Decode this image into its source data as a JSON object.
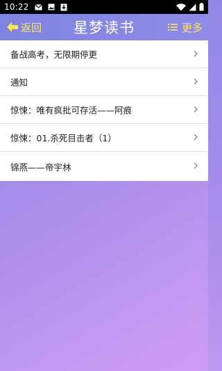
{
  "status_bar": {
    "time": "10:22",
    "left_icons": [
      "mail-icon",
      "image-icon",
      "download-icon"
    ],
    "right_icons": [
      "wifi-icon",
      "signal-icon",
      "battery-icon"
    ]
  },
  "header": {
    "back_label": "返回",
    "title": "星梦读书",
    "more_label": "更多",
    "accent_color": "#ffe45a"
  },
  "list": {
    "items": [
      {
        "label": "备战高考，无限期停更"
      },
      {
        "label": "通知"
      },
      {
        "label": "惊悚：唯有疯批可存活——阿痕"
      },
      {
        "label": "惊悚：01.杀死目击者（1）"
      },
      {
        "label": "锦燕——帝宇林"
      }
    ]
  }
}
